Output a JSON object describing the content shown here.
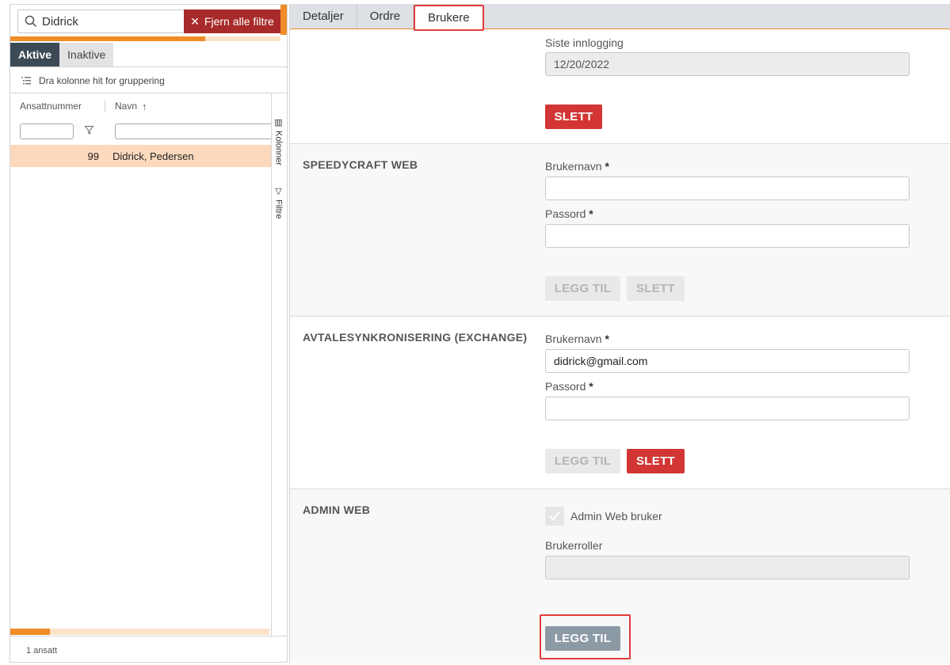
{
  "sidebar": {
    "search_value": "Didrick",
    "clear_filters_label": "Fjern alle filtre",
    "status_tabs": [
      "Aktive",
      "Inaktive"
    ],
    "group_hint": "Dra kolonne hit for gruppering",
    "columns": [
      "Ansattnummer",
      "Navn"
    ],
    "rows": [
      {
        "number": "99",
        "name": "Didrick, Pedersen"
      }
    ],
    "side_labels": [
      "Kolonner",
      "Filtre"
    ],
    "footer": "1 ansatt"
  },
  "tabs": [
    "Detaljer",
    "Ordre",
    "Brukere"
  ],
  "active_tab": "Brukere",
  "top_section": {
    "last_login_label": "Siste innlogging",
    "last_login_value": "12/20/2022",
    "delete_label": "SLETT"
  },
  "speedycraft": {
    "title": "SPEEDYCRAFT WEB",
    "username_label": "Brukernavn",
    "username_value": "",
    "password_label": "Passord",
    "add_label": "LEGG TIL",
    "delete_label": "SLETT"
  },
  "exchange": {
    "title": "AVTALESYNKRONISERING (EXCHANGE)",
    "username_label": "Brukernavn",
    "username_value": "didrick@gmail.com",
    "password_label": "Passord",
    "add_label": "LEGG TIL",
    "delete_label": "SLETT"
  },
  "admin": {
    "title": "ADMIN WEB",
    "checkbox_label": "Admin Web bruker",
    "checkbox_checked": true,
    "roles_label": "Brukerroller",
    "add_label": "LEGG TIL"
  },
  "required_marker": "*",
  "colors": {
    "accent": "#f08c28",
    "danger": "#d33535",
    "highlight": "#e23b3b",
    "dark_tab": "#3c4a55"
  }
}
